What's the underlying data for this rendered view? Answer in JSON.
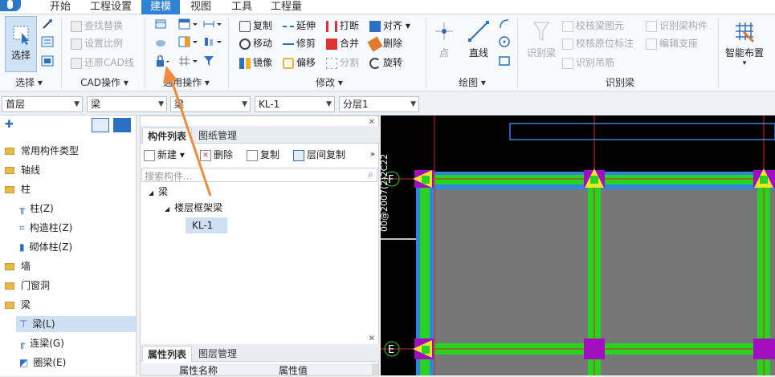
{
  "menubar": {
    "items": [
      "开始",
      "工程设置",
      "建模",
      "视图",
      "工具",
      "工程量"
    ],
    "active": "建模"
  },
  "ribbon": {
    "select": {
      "label": "选择",
      "group": "选择"
    },
    "cad": {
      "items": [
        "查找替换",
        "设置比例",
        "还原CAD线"
      ],
      "group": "CAD操作"
    },
    "common": {
      "group": "通用操作"
    },
    "modify": {
      "items": [
        "复制",
        "延伸",
        "打断",
        "对齐",
        "移动",
        "修剪",
        "合并",
        "删除",
        "镜像",
        "偏移",
        "分割",
        "旋转"
      ],
      "group": "修改"
    },
    "draw": {
      "point": "点",
      "line": "直线",
      "group": "绘图"
    },
    "identify": {
      "items": [
        "识别梁",
        "校核梁图元",
        "识别梁构件",
        "校核原位标注",
        "编辑支座",
        "识别吊筋"
      ],
      "group": "识别梁"
    },
    "smart": {
      "label": "智能布置"
    }
  },
  "toolbar": {
    "floor": "首层",
    "category": "梁",
    "type": "梁",
    "component": "KL-1",
    "layer": "分层1"
  },
  "left_tree": {
    "items": [
      {
        "label": "常用构件类型",
        "kind": "folder",
        "expanded": false
      },
      {
        "label": "轴线",
        "kind": "folder",
        "expanded": false
      },
      {
        "label": "柱",
        "kind": "folder",
        "expanded": true
      },
      {
        "label": "柱(Z)",
        "kind": "child"
      },
      {
        "label": "构造柱(Z)",
        "kind": "child"
      },
      {
        "label": "砌体柱(Z)",
        "kind": "child"
      },
      {
        "label": "墙",
        "kind": "folder",
        "expanded": false
      },
      {
        "label": "门窗洞",
        "kind": "folder",
        "expanded": false
      },
      {
        "label": "梁",
        "kind": "folder",
        "expanded": true
      },
      {
        "label": "梁(L)",
        "kind": "child",
        "selected": true
      },
      {
        "label": "连梁(G)",
        "kind": "child"
      },
      {
        "label": "圈梁(E)",
        "kind": "child"
      }
    ]
  },
  "component_panel": {
    "tabs": [
      "构件列表",
      "图纸管理"
    ],
    "actions": [
      "新建",
      "删除",
      "复制",
      "层间复制"
    ],
    "search_placeholder": "搜索构件...",
    "tree": {
      "root": "梁",
      "group": "楼层框架梁",
      "item": "KL-1"
    }
  },
  "property_panel": {
    "tabs": [
      "属性列表",
      "图层管理"
    ],
    "columns": [
      "属性名称",
      "属性值"
    ]
  },
  "canvas": {
    "axis_labels": [
      "F",
      "E"
    ],
    "side_text": "00@2007(2)2C22"
  },
  "colors": {
    "accent": "#2f82d6",
    "beam": "#27d31f",
    "column": "#a30dc0",
    "wall_fill": "#777777",
    "arrow": "#f08a3c"
  }
}
